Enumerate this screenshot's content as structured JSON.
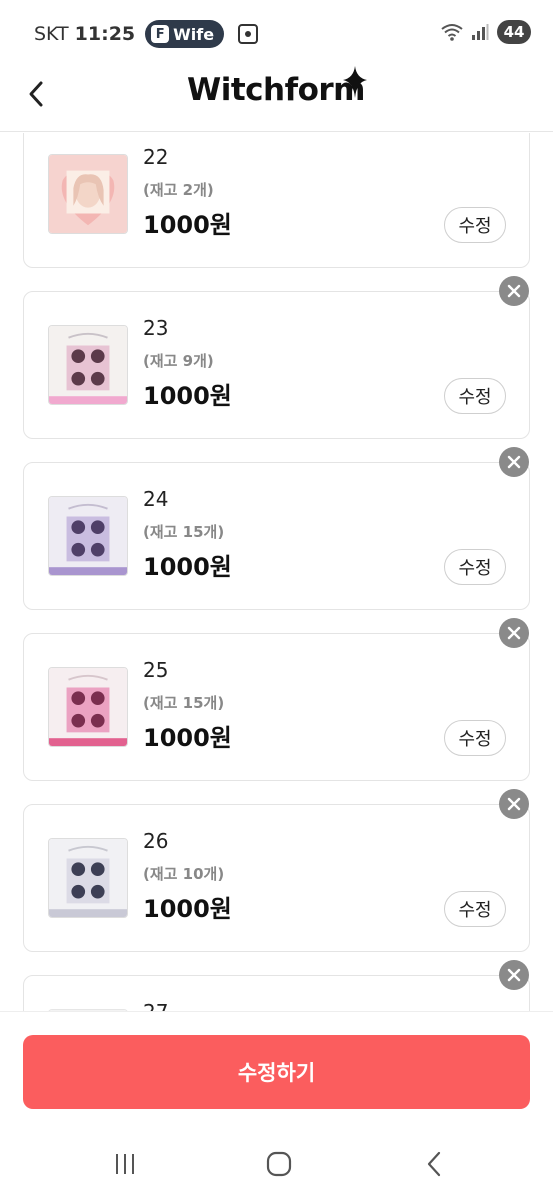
{
  "status_bar": {
    "carrier": "SKT",
    "time": "11:25",
    "pill_icon_letter": "F",
    "pill_label": "Wife",
    "battery": "44"
  },
  "header": {
    "logo_text": "Witchform"
  },
  "items": [
    {
      "number": "22",
      "stock": "(재고 2개)",
      "price": "1000원",
      "edit_label": "수정",
      "thumb": "pink-portrait"
    },
    {
      "number": "23",
      "stock": "(재고 9개)",
      "price": "1000원",
      "edit_label": "수정",
      "thumb": "pink-grid"
    },
    {
      "number": "24",
      "stock": "(재고 15개)",
      "price": "1000원",
      "edit_label": "수정",
      "thumb": "purple-grid"
    },
    {
      "number": "25",
      "stock": "(재고 15개)",
      "price": "1000원",
      "edit_label": "수정",
      "thumb": "magenta-grid"
    },
    {
      "number": "26",
      "stock": "(재고 10개)",
      "price": "1000원",
      "edit_label": "수정",
      "thumb": "silver-grid"
    },
    {
      "number": "27",
      "stock": "",
      "price": "",
      "edit_label": "",
      "thumb": "partial"
    }
  ],
  "footer": {
    "submit_label": "수정하기"
  },
  "colors": {
    "accent": "#fb5d5e",
    "remove_badge": "#8a8a8a"
  },
  "icons": [
    "back-chevron-icon",
    "remove-x-icon",
    "recent-apps-icon",
    "home-icon",
    "nav-back-icon"
  ]
}
